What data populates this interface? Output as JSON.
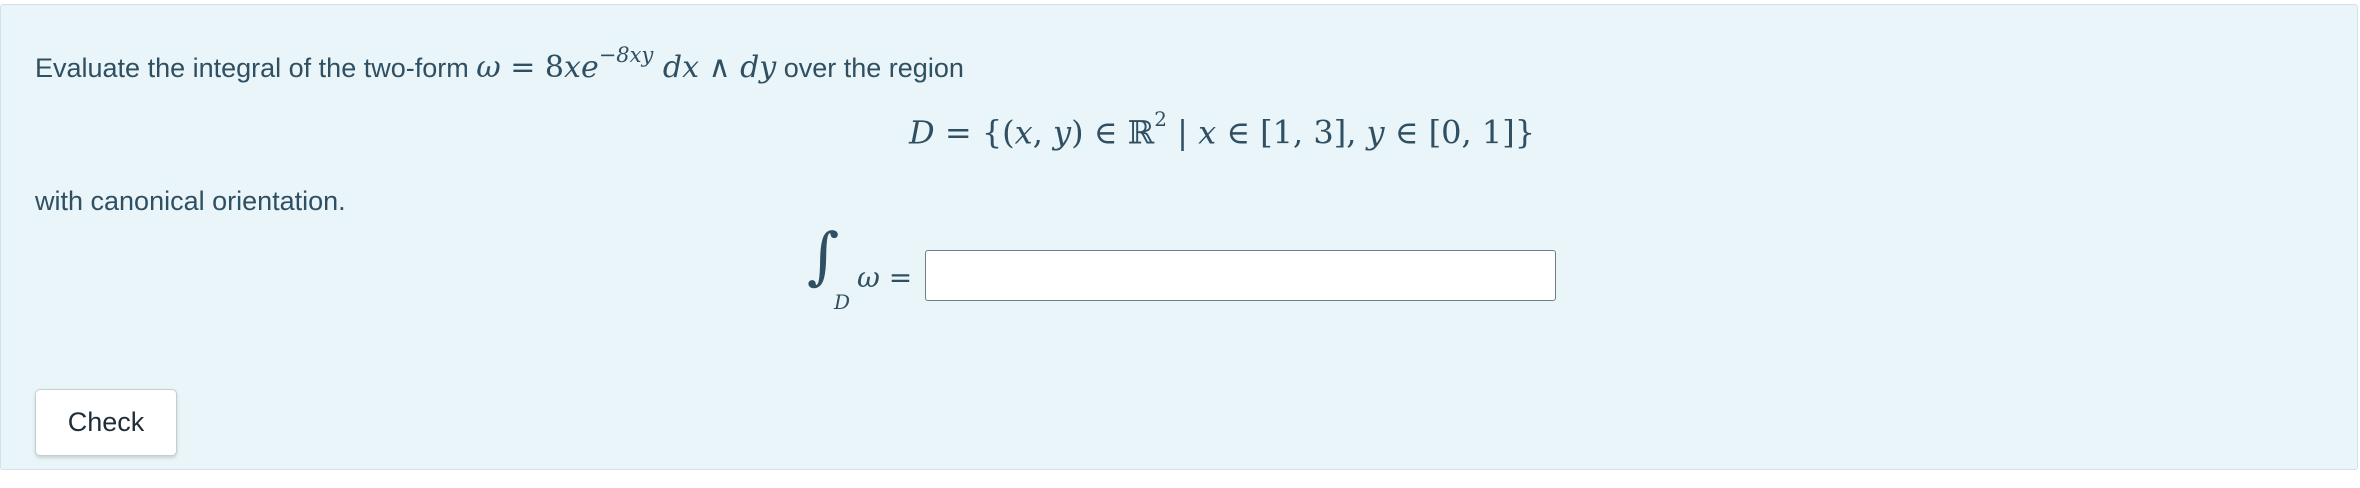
{
  "question": {
    "intro_prefix": "Evaluate the integral of the two-form ",
    "omega_symbol": "ω",
    "equals": " = ",
    "form_coeff": "8",
    "form_x": "x",
    "form_e": "e",
    "form_exponent": "−8xy",
    "form_dx": " dx",
    "wedge": " ∧ ",
    "form_dy": "dy",
    "intro_suffix": " over the region",
    "region_lhs": "D",
    "region_eq": " = {(",
    "region_x": "x",
    "region_comma": ", ",
    "region_y": "y",
    "region_in_r": ") ∈ ℝ",
    "region_r_power": "2",
    "region_bar": " | ",
    "region_cond_x": "x",
    "region_cond_x_range": " ∈ [1, 3], ",
    "region_cond_y": "y",
    "region_cond_y_range": " ∈ [0, 1]}",
    "orientation_text": "with canonical orientation."
  },
  "integral": {
    "sign": "∫",
    "subscript": "D",
    "integrand": "ω =",
    "answer_value": "",
    "answer_placeholder": ""
  },
  "actions": {
    "check_label": "Check"
  }
}
